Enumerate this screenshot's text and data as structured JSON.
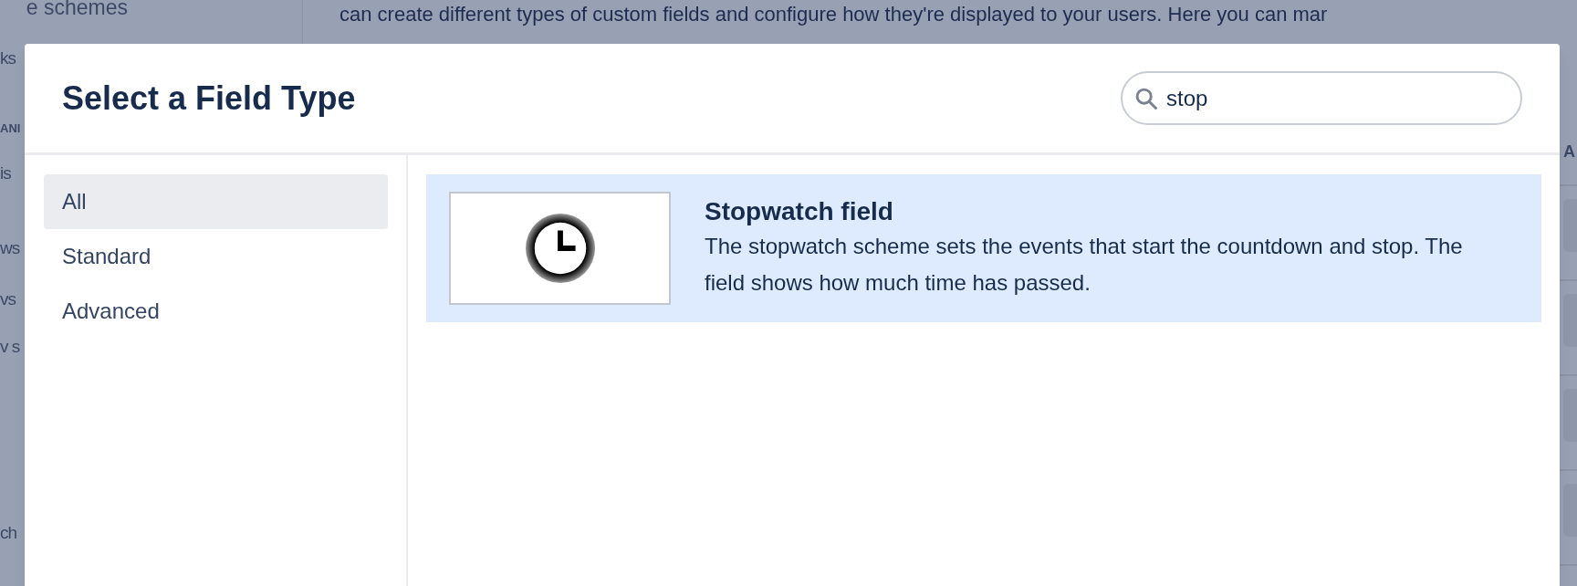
{
  "background": {
    "sidebar_items": [
      {
        "label": "e schemes",
        "kind": "link"
      },
      {
        "label": "ks",
        "kind": "link"
      },
      {
        "label": "ANI",
        "kind": "heading"
      },
      {
        "label": "is",
        "kind": "link"
      },
      {
        "label": "ws",
        "kind": "link"
      },
      {
        "label": "vs",
        "kind": "link"
      },
      {
        "label": "v s",
        "kind": "link"
      },
      {
        "label": "ch",
        "kind": "link"
      }
    ],
    "intro_text": "can create different types of custom fields and configure how they're displayed to your users. Here you can mar",
    "side_panel_label": "A"
  },
  "dialog": {
    "title": "Select a Field Type",
    "search": {
      "value": "stop"
    },
    "categories": [
      {
        "label": "All",
        "selected": true
      },
      {
        "label": "Standard",
        "selected": false
      },
      {
        "label": "Advanced",
        "selected": false
      }
    ],
    "results": [
      {
        "title": "Stopwatch field",
        "description": "The stopwatch scheme sets the events that start the countdown and stop. The field shows how much time has passed.",
        "selected": true
      }
    ]
  }
}
